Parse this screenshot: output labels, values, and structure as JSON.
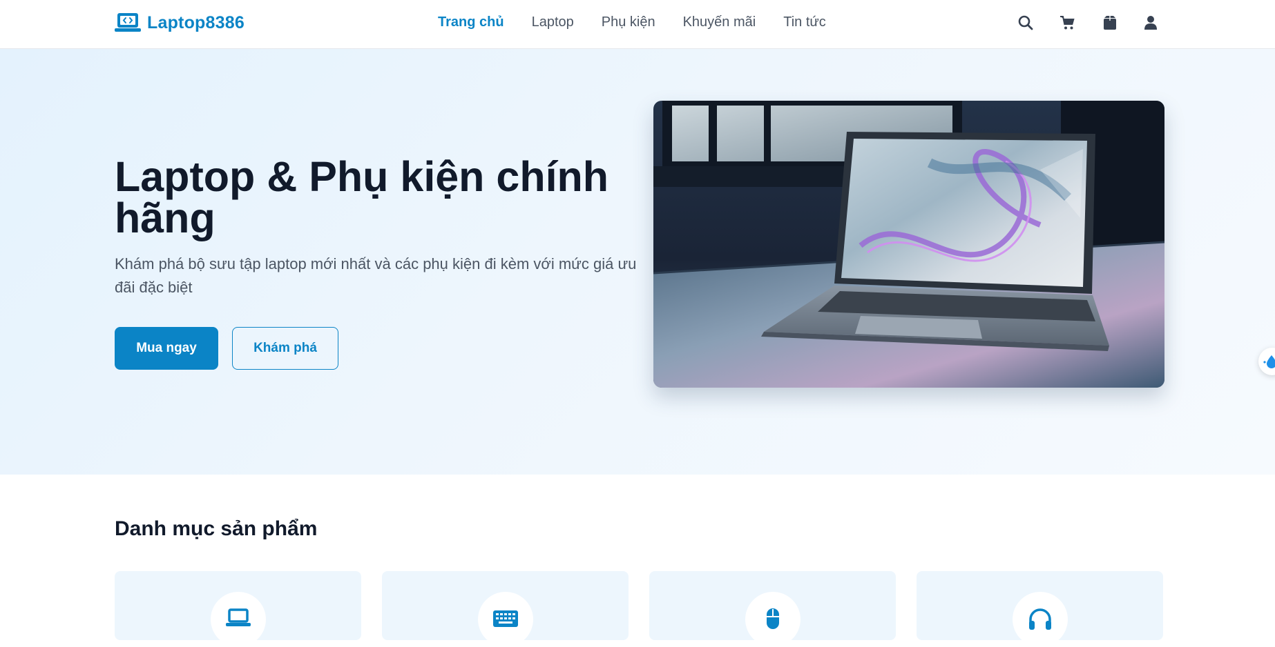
{
  "brand": {
    "name": "Laptop8386",
    "color": "#0b84c6"
  },
  "nav": {
    "items": [
      {
        "label": "Trang chủ",
        "active": true
      },
      {
        "label": "Laptop",
        "active": false
      },
      {
        "label": "Phụ kiện",
        "active": false
      },
      {
        "label": "Khuyến mãi",
        "active": false
      },
      {
        "label": "Tin tức",
        "active": false
      }
    ]
  },
  "header_icons": [
    "search-icon",
    "cart-icon",
    "box-icon",
    "user-icon"
  ],
  "hero": {
    "title": "Laptop & Phụ kiện chính hãng",
    "subtitle": "Khám phá bộ sưu tập laptop mới nhất và các phụ kiện đi kèm với mức giá ưu đãi đặc biệt",
    "primary_button": "Mua ngay",
    "secondary_button": "Khám phá",
    "image_subject": "laptop-photo"
  },
  "categories": {
    "title": "Danh mục sản phẩm",
    "icons": [
      "laptop-icon",
      "keyboard-icon",
      "mouse-icon",
      "headphones-icon"
    ]
  },
  "colors": {
    "accent": "#0b84c6",
    "heading": "#111a2b",
    "body_text": "#4b5563",
    "hero_bg": "#e9f4fd",
    "card_bg": "#edf6fd"
  }
}
